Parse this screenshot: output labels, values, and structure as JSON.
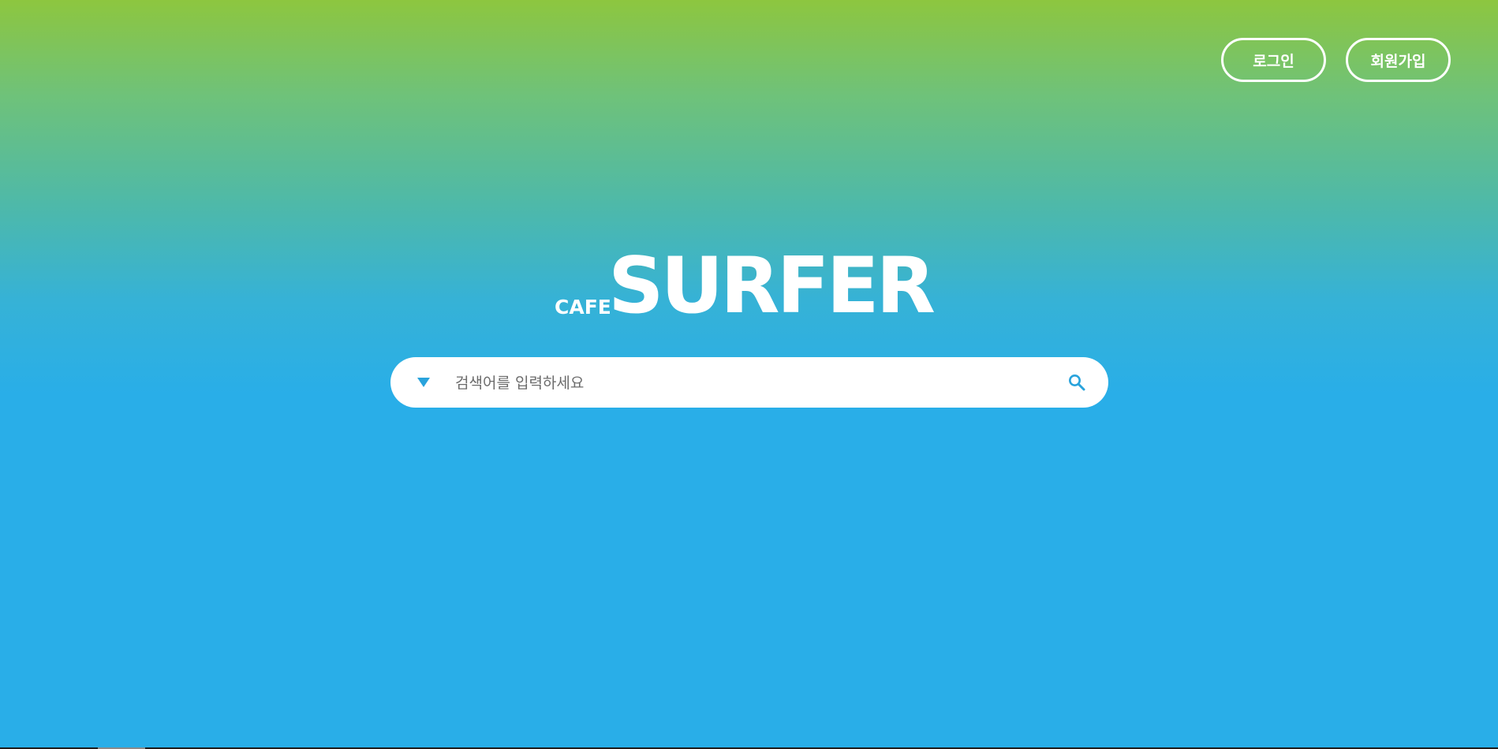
{
  "header": {
    "login_label": "로그인",
    "signup_label": "회원가입"
  },
  "logo": {
    "small_text": "CAFE",
    "big_text": "SURFER"
  },
  "search": {
    "placeholder": "검색어를 입력하세요",
    "value": "",
    "dropdown_icon": "triangle-down-icon",
    "submit_icon": "search-icon"
  },
  "colors": {
    "gradient_top": "#8dc63f",
    "gradient_bottom": "#29aee8",
    "accent_blue": "#29a3dc",
    "white": "#ffffff"
  }
}
